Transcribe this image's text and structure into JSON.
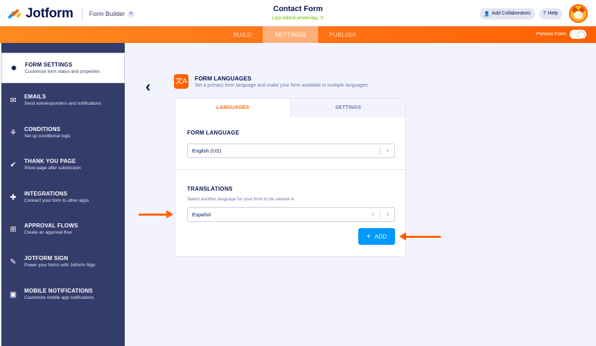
{
  "header": {
    "brand": "Jotform",
    "product": "Form Builder",
    "form_title": "Contact Form",
    "last_edited": "Last edited yesterday.",
    "add_collaborators": "Add Collaborators",
    "help": "Help"
  },
  "nav": {
    "tabs": [
      "BUILD",
      "SETTINGS",
      "PUBLISH"
    ],
    "active_tab": "SETTINGS",
    "preview_label": "Preview Form",
    "preview_on": false
  },
  "sidebar": {
    "items": [
      {
        "title": "FORM SETTINGS",
        "desc": "Customize form status and properties",
        "icon": "gear-icon",
        "active": true
      },
      {
        "title": "EMAILS",
        "desc": "Send autoresponders and notifications",
        "icon": "envelope-icon",
        "active": false
      },
      {
        "title": "CONDITIONS",
        "desc": "Set up conditional logic",
        "icon": "flow-icon",
        "active": false
      },
      {
        "title": "THANK YOU PAGE",
        "desc": "Show page after submission",
        "icon": "check-circle-icon",
        "active": false
      },
      {
        "title": "INTEGRATIONS",
        "desc": "Connect your form to other apps",
        "icon": "puzzle-icon",
        "active": false
      },
      {
        "title": "APPROVAL FLOWS",
        "desc": "Create an approval flow",
        "icon": "approval-icon",
        "active": false
      },
      {
        "title": "JOTFORM SIGN",
        "desc": "Power your forms with Jotform Sign",
        "icon": "pen-icon",
        "active": false
      },
      {
        "title": "MOBILE NOTIFICATIONS",
        "desc": "Customize mobile app notifications",
        "icon": "mobile-icon",
        "active": false
      }
    ]
  },
  "section": {
    "title": "FORM LANGUAGES",
    "desc": "Set a primary form language and make your form available in multiple languages."
  },
  "card": {
    "tabs": [
      "LANGUAGES",
      "SETTINGS"
    ],
    "form_language_label": "FORM LANGUAGE",
    "form_language_value": "English (US)",
    "translations_label": "TRANSLATIONS",
    "translations_help": "Select another language for your form to be viewed in",
    "translation_value": "Español",
    "add_label": "ADD"
  },
  "colors": {
    "accent": "#ff6100",
    "primary_button": "#0099ff",
    "sidebar_bg": "#343c6a"
  }
}
